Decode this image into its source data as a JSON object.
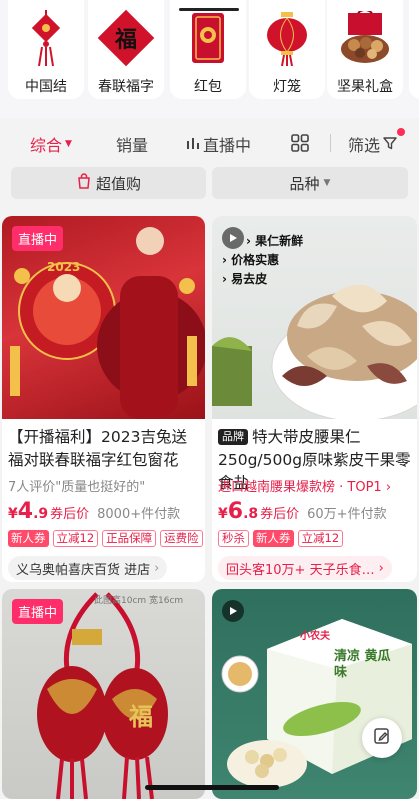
{
  "categories": [
    {
      "label": "中国结",
      "icon": "chinese-knot-icon"
    },
    {
      "label": "春联福字",
      "icon": "fu-character-icon",
      "glyph": "福"
    },
    {
      "label": "红包",
      "icon": "red-envelope-icon"
    },
    {
      "label": "灯笼",
      "icon": "lantern-icon"
    },
    {
      "label": "坚果礼盒",
      "icon": "nut-gift-box-icon"
    }
  ],
  "sort": {
    "comprehensive": "综合",
    "sales": "销量",
    "live": "直播中",
    "filter": "筛选"
  },
  "pills": {
    "deals": "超值购",
    "variety": "品种"
  },
  "products": [
    {
      "badge": "直播中",
      "photo_text": "2023",
      "title": "【开播福利】2023吉兔送福对联春联福字红包窗花",
      "subtitle": "7人评价\"质量也挺好的\"",
      "price": {
        "yen": "¥",
        "int": "4",
        "dec": ".9",
        "after": "券后价",
        "sold": "8000+件付款"
      },
      "tags": [
        "新人券",
        "立减12",
        "正品保障",
        "运费险"
      ],
      "shop": "义乌奥帕喜庆百货 进店"
    },
    {
      "photo_bullets": [
        "果仁新鲜",
        "价格实惠",
        "易去皮"
      ],
      "brand": "品牌",
      "title": "特大带皮腰果仁250g/500g原味紫皮干果零食盐",
      "subtitle": "进口越南腰果爆款榜 · TOP1",
      "price": {
        "yen": "¥",
        "int": "6",
        "dec": ".8",
        "after": "券后价",
        "sold": "60万+件付款"
      },
      "tags": [
        "秒杀",
        "新人券",
        "立减12"
      ],
      "shop": "回头客10万+  天子乐食…"
    },
    {
      "badge": "直播中",
      "photo_text": "此图高10cm 宽16cm",
      "fu": "福"
    },
    {
      "box_text": "清凉 黄瓜味",
      "brand_small": "小农夫"
    }
  ],
  "colors": {
    "accent": "#e6204a",
    "live": "#ff2d6a",
    "tag": "#ff4a6a"
  }
}
